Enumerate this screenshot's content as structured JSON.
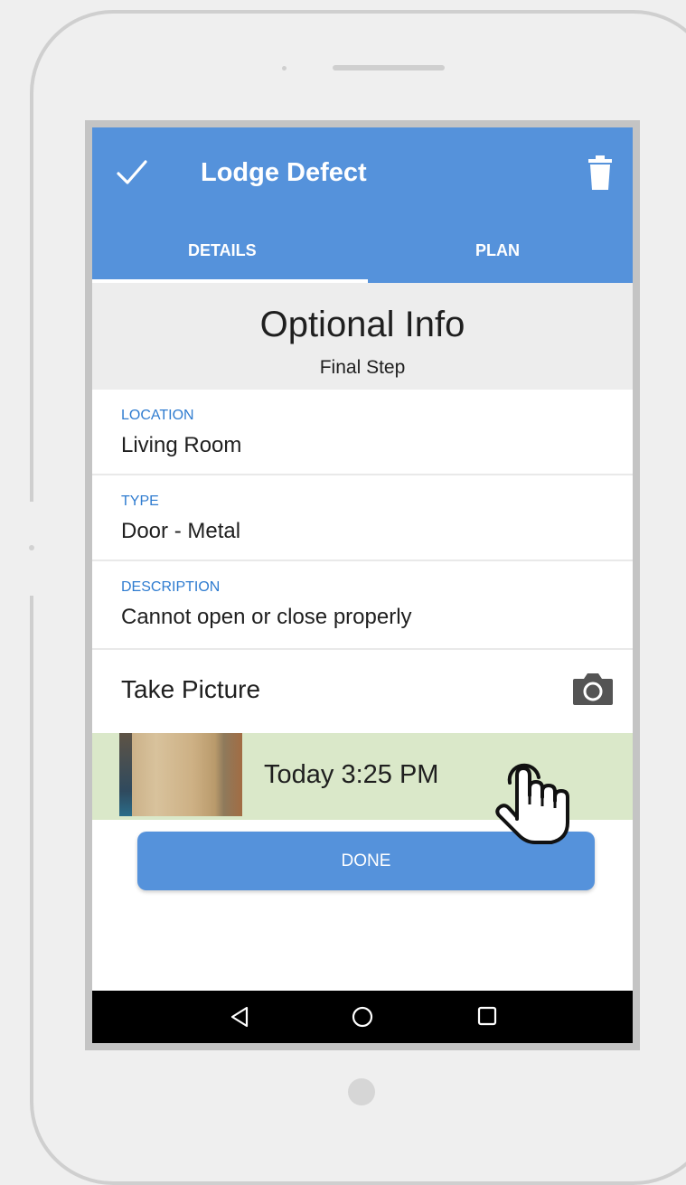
{
  "app": {
    "title": "Lodge Defect",
    "tabs": [
      {
        "label": "DETAILS",
        "active": true
      },
      {
        "label": "PLAN",
        "active": false
      }
    ],
    "accent_color": "#5592db"
  },
  "header": {
    "title": "Optional Info",
    "subtitle": "Final Step"
  },
  "fields": [
    {
      "label": "LOCATION",
      "value": "Living Room"
    },
    {
      "label": "TYPE",
      "value": "Door - Metal"
    },
    {
      "label": "DESCRIPTION",
      "value": "Cannot open or close properly"
    }
  ],
  "picture": {
    "label": "Take Picture",
    "photo_time": "Today 3:25 PM"
  },
  "actions": {
    "done_label": "DONE"
  },
  "icons": [
    "check-icon",
    "trash-icon",
    "camera-icon",
    "back-icon",
    "home-icon",
    "recent-apps-icon",
    "tap-hand-icon"
  ]
}
